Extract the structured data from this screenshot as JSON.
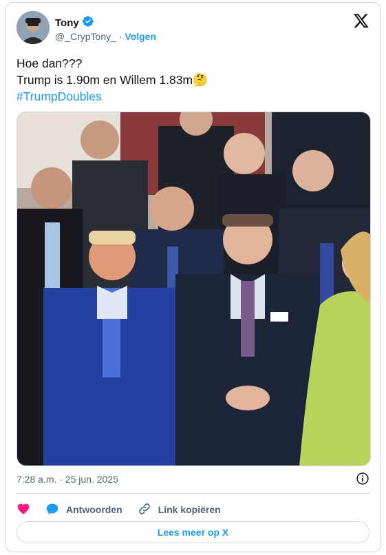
{
  "author": {
    "name": "Tony",
    "handle": "@_CrypTony_",
    "separator": "·",
    "follow_label": "Volgen"
  },
  "tweet": {
    "lines": [
      "Hoe dan???",
      "Trump is 1.90m en Willem 1.83m"
    ],
    "emoji": "🤔",
    "hashtag": "#TrumpDoubles"
  },
  "meta": {
    "timestamp": "7:28 a.m. · 25 jun. 2025"
  },
  "actions": {
    "reply_label": "Antwoorden",
    "copy_link_label": "Link kopiëren"
  },
  "more_button": "Lees meer op X",
  "colors": {
    "accent": "#1d9bf0",
    "like": "#f91880",
    "muted": "#536471",
    "border": "#cfd9de"
  },
  "icons": [
    "verified-badge-icon",
    "x-logo-icon",
    "info-icon",
    "heart-icon",
    "reply-bubble-icon",
    "link-icon"
  ]
}
